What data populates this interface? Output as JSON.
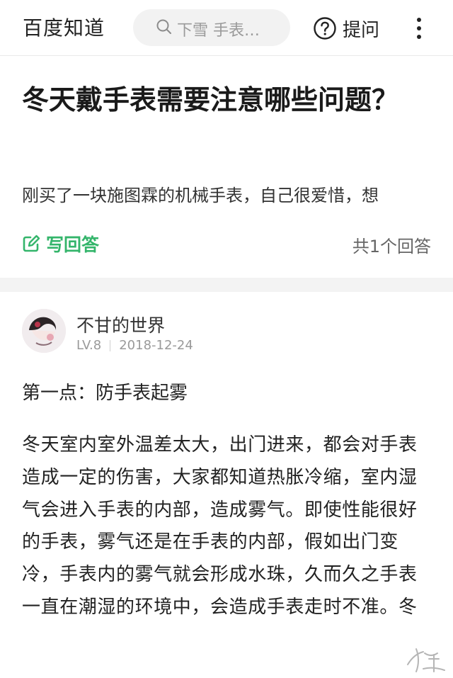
{
  "header": {
    "app_name": "百度知道",
    "search_text": "下雪 手表…",
    "ask_label": "提问"
  },
  "question": {
    "title": "冬天戴手表需要注意哪些问题？",
    "description": "刚买了一块施图霖的机械手表，自己很爱惜，想",
    "write_answer_label": "写回答",
    "answer_count": "共1个回答"
  },
  "answer": {
    "user_name": "不甘的世界",
    "level": "LV.8",
    "date": "2018-12-24",
    "section_title": "第一点：防手表起雾",
    "body": "冬天室内室外温差太大，出门进来，都会对手表造成一定的伤害，大家都知道热胀冷缩，室内湿气会进入手表的内部，造成雾气。即使性能很好的手表，雾气还是在手表的内部，假如出门变冷，手表内的雾气就会形成水珠，久而久之手表一直在潮湿的环境中，会造成手表走时不准。冬"
  },
  "colors": {
    "accent_green": "#34b56b",
    "text_primary": "#222222",
    "text_secondary": "#9a9a9a",
    "divider": "#f3f3f3"
  },
  "icons": {
    "search": "search-icon",
    "ask": "question-circle-icon",
    "more": "more-vertical-icon",
    "write": "edit-icon"
  }
}
